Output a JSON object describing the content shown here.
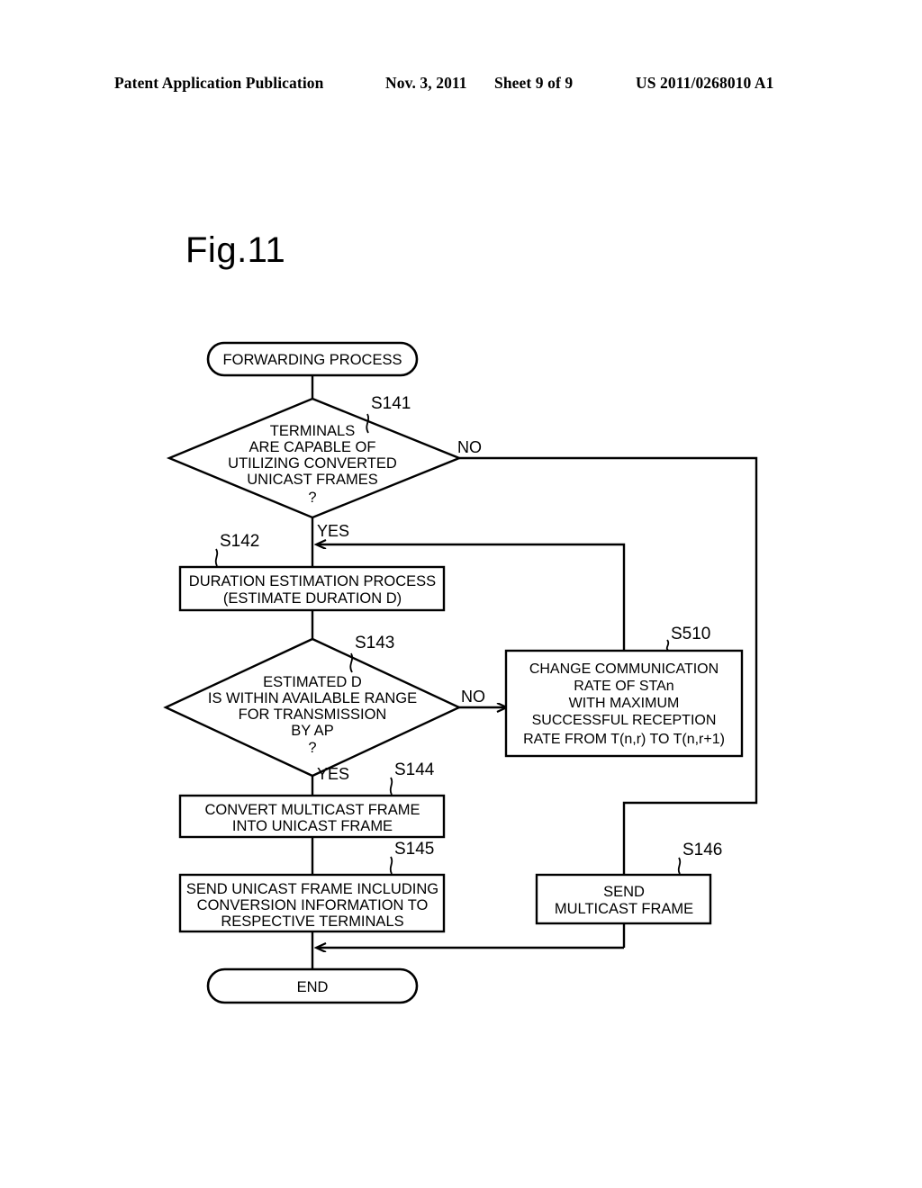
{
  "header": {
    "publication": "Patent Application Publication",
    "date": "Nov. 3, 2011",
    "sheet": "Sheet 9 of 9",
    "number": "US 2011/0268010 A1"
  },
  "figure": {
    "title": "Fig.11",
    "type": "flowchart",
    "nodes": [
      {
        "id": "start",
        "shape": "terminator",
        "label": "FORWARDING PROCESS",
        "lines": [
          "FORWARDING PROCESS"
        ],
        "step": null
      },
      {
        "id": "s141",
        "shape": "decision",
        "step": "S141",
        "lines": [
          "TERMINALS",
          "ARE CAPABLE OF",
          "UTILIZING CONVERTED",
          "UNICAST FRAMES",
          "?"
        ],
        "yes_label": "YES",
        "no_label": "NO"
      },
      {
        "id": "s142",
        "shape": "process",
        "step": "S142",
        "lines": [
          "DURATION ESTIMATION PROCESS",
          "(ESTIMATE DURATION D)"
        ]
      },
      {
        "id": "s143",
        "shape": "decision",
        "step": "S143",
        "lines": [
          "ESTIMATED D",
          "IS WITHIN AVAILABLE RANGE",
          "FOR TRANSMISSION",
          "BY AP",
          "?"
        ],
        "yes_label": "YES",
        "no_label": "NO"
      },
      {
        "id": "s510",
        "shape": "process",
        "step": "S510",
        "lines": [
          "CHANGE COMMUNICATION",
          "RATE OF STAn",
          "WITH MAXIMUM",
          "SUCCESSFUL RECEPTION",
          "RATE FROM T(n,r) TO T(n,r+1)"
        ]
      },
      {
        "id": "s144",
        "shape": "process",
        "step": "S144",
        "lines": [
          "CONVERT MULTICAST FRAME",
          "INTO UNICAST FRAME"
        ]
      },
      {
        "id": "s145",
        "shape": "process",
        "step": "S145",
        "lines": [
          "SEND UNICAST FRAME INCLUDING",
          "CONVERSION INFORMATION TO",
          "RESPECTIVE TERMINALS"
        ]
      },
      {
        "id": "s146",
        "shape": "process",
        "step": "S146",
        "lines": [
          "SEND",
          "MULTICAST FRAME"
        ]
      },
      {
        "id": "end",
        "shape": "terminator",
        "label": "END",
        "lines": [
          "END"
        ],
        "step": null
      }
    ],
    "text": {
      "start_label": "FORWARDING PROCESS",
      "end_label": "END",
      "s141_l1": "TERMINALS",
      "s141_l2": "ARE CAPABLE OF",
      "s141_l3": "UTILIZING CONVERTED",
      "s141_l4": "UNICAST FRAMES",
      "s141_l5": "?",
      "s141_step": "S141",
      "s141_no": "NO",
      "s141_yes": "YES",
      "s142_l1": "DURATION ESTIMATION PROCESS",
      "s142_l2": "(ESTIMATE DURATION D)",
      "s142_step": "S142",
      "s143_l1": "ESTIMATED D",
      "s143_l2": "IS WITHIN AVAILABLE RANGE",
      "s143_l3": "FOR TRANSMISSION",
      "s143_l4": "BY AP",
      "s143_l5": "?",
      "s143_step": "S143",
      "s143_no": "NO",
      "s143_yes": "YES",
      "s510_l1": "CHANGE COMMUNICATION",
      "s510_l2": "RATE OF STAn",
      "s510_l3": "WITH MAXIMUM",
      "s510_l4": "SUCCESSFUL RECEPTION",
      "s510_l5": "RATE FROM T(n,r) TO T(n,r+1)",
      "s510_step": "S510",
      "s144_l1": "CONVERT MULTICAST FRAME",
      "s144_l2": "INTO UNICAST FRAME",
      "s144_step": "S144",
      "s145_l1": "SEND UNICAST FRAME INCLUDING",
      "s145_l2": "CONVERSION INFORMATION TO",
      "s145_l3": "RESPECTIVE TERMINALS",
      "s145_step": "S145",
      "s146_l1": "SEND",
      "s146_l2": "MULTICAST FRAME",
      "s146_step": "S146"
    }
  },
  "colors": {
    "ink": "#000000",
    "paper": "#ffffff"
  }
}
